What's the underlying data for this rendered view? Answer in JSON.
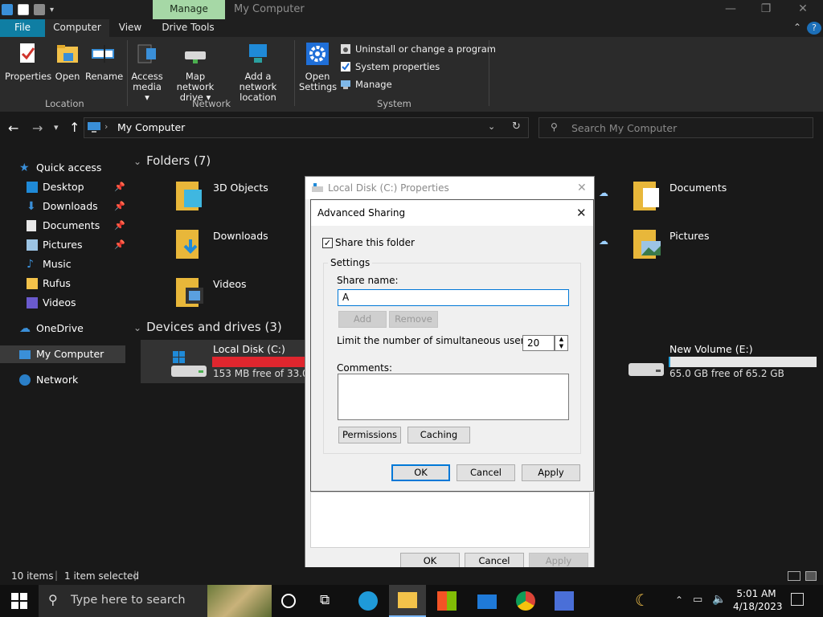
{
  "window": {
    "title": "My Computer",
    "context_tab": "Manage",
    "controls": [
      "—",
      "❐",
      "✕"
    ]
  },
  "ribbon": {
    "tabs": [
      "File",
      "Computer",
      "View",
      "Drive Tools"
    ],
    "location": {
      "group_label": "Location",
      "properties": "Properties",
      "open": "Open",
      "rename": "Rename"
    },
    "network": {
      "group_label": "Network",
      "access_media_1": "Access",
      "access_media_2": "media ▾",
      "map_drive_1": "Map network",
      "map_drive_2": "drive ▾",
      "add_location_1": "Add a network",
      "add_location_2": "location"
    },
    "system": {
      "group_label": "System",
      "open_settings_1": "Open",
      "open_settings_2": "Settings",
      "uninstall": "Uninstall or change a program",
      "system_properties": "System properties",
      "manage": "Manage"
    }
  },
  "address": {
    "path": "My Computer",
    "search_placeholder": "Search My Computer"
  },
  "nav": {
    "quick_access": "Quick access",
    "items": [
      "Desktop",
      "Downloads",
      "Documents",
      "Pictures",
      "Music",
      "Rufus",
      "Videos"
    ],
    "onedrive": "OneDrive",
    "my_computer": "My Computer",
    "network": "Network"
  },
  "content": {
    "folders_header": "Folders (7)",
    "folders": [
      "3D Objects",
      "Documents",
      "Downloads",
      "Pictures",
      "Videos"
    ],
    "devices_header": "Devices and drives (3)",
    "drive_c": {
      "name": "Local Disk (C:)",
      "free": "153 MB free of 33.0 GB",
      "used_fraction": 0.995
    },
    "drive_e": {
      "name": "New Volume (E:)",
      "free": "65.0 GB free of 65.2 GB",
      "used_fraction": 0.003
    }
  },
  "props_dialog": {
    "title": "Local Disk (C:) Properties",
    "ok": "OK",
    "cancel": "Cancel",
    "apply": "Apply"
  },
  "adv_dialog": {
    "title": "Advanced Sharing",
    "share_checkbox": "Share this folder",
    "share_checked": true,
    "settings_label": "Settings",
    "share_name_label": "Share name:",
    "share_name_value": "A",
    "add": "Add",
    "remove": "Remove",
    "limit_label": "Limit the number of simultaneous users to:",
    "limit_value": "20",
    "comments_label": "Comments:",
    "permissions": "Permissions",
    "caching": "Caching",
    "ok": "OK",
    "cancel": "Cancel",
    "apply": "Apply"
  },
  "status": {
    "items_count": "10 items",
    "selected": "1 item selected"
  },
  "taskbar": {
    "search_placeholder": "Type here to search",
    "time": "5:01 AM",
    "date": "4/18/2023"
  },
  "colors": {
    "accent": "#0078d7",
    "file_tab": "#0f7ea3",
    "manage_tab": "#a6d8a6",
    "drive_full": "#e0262e",
    "drive_ok": "#e6e6e6"
  }
}
